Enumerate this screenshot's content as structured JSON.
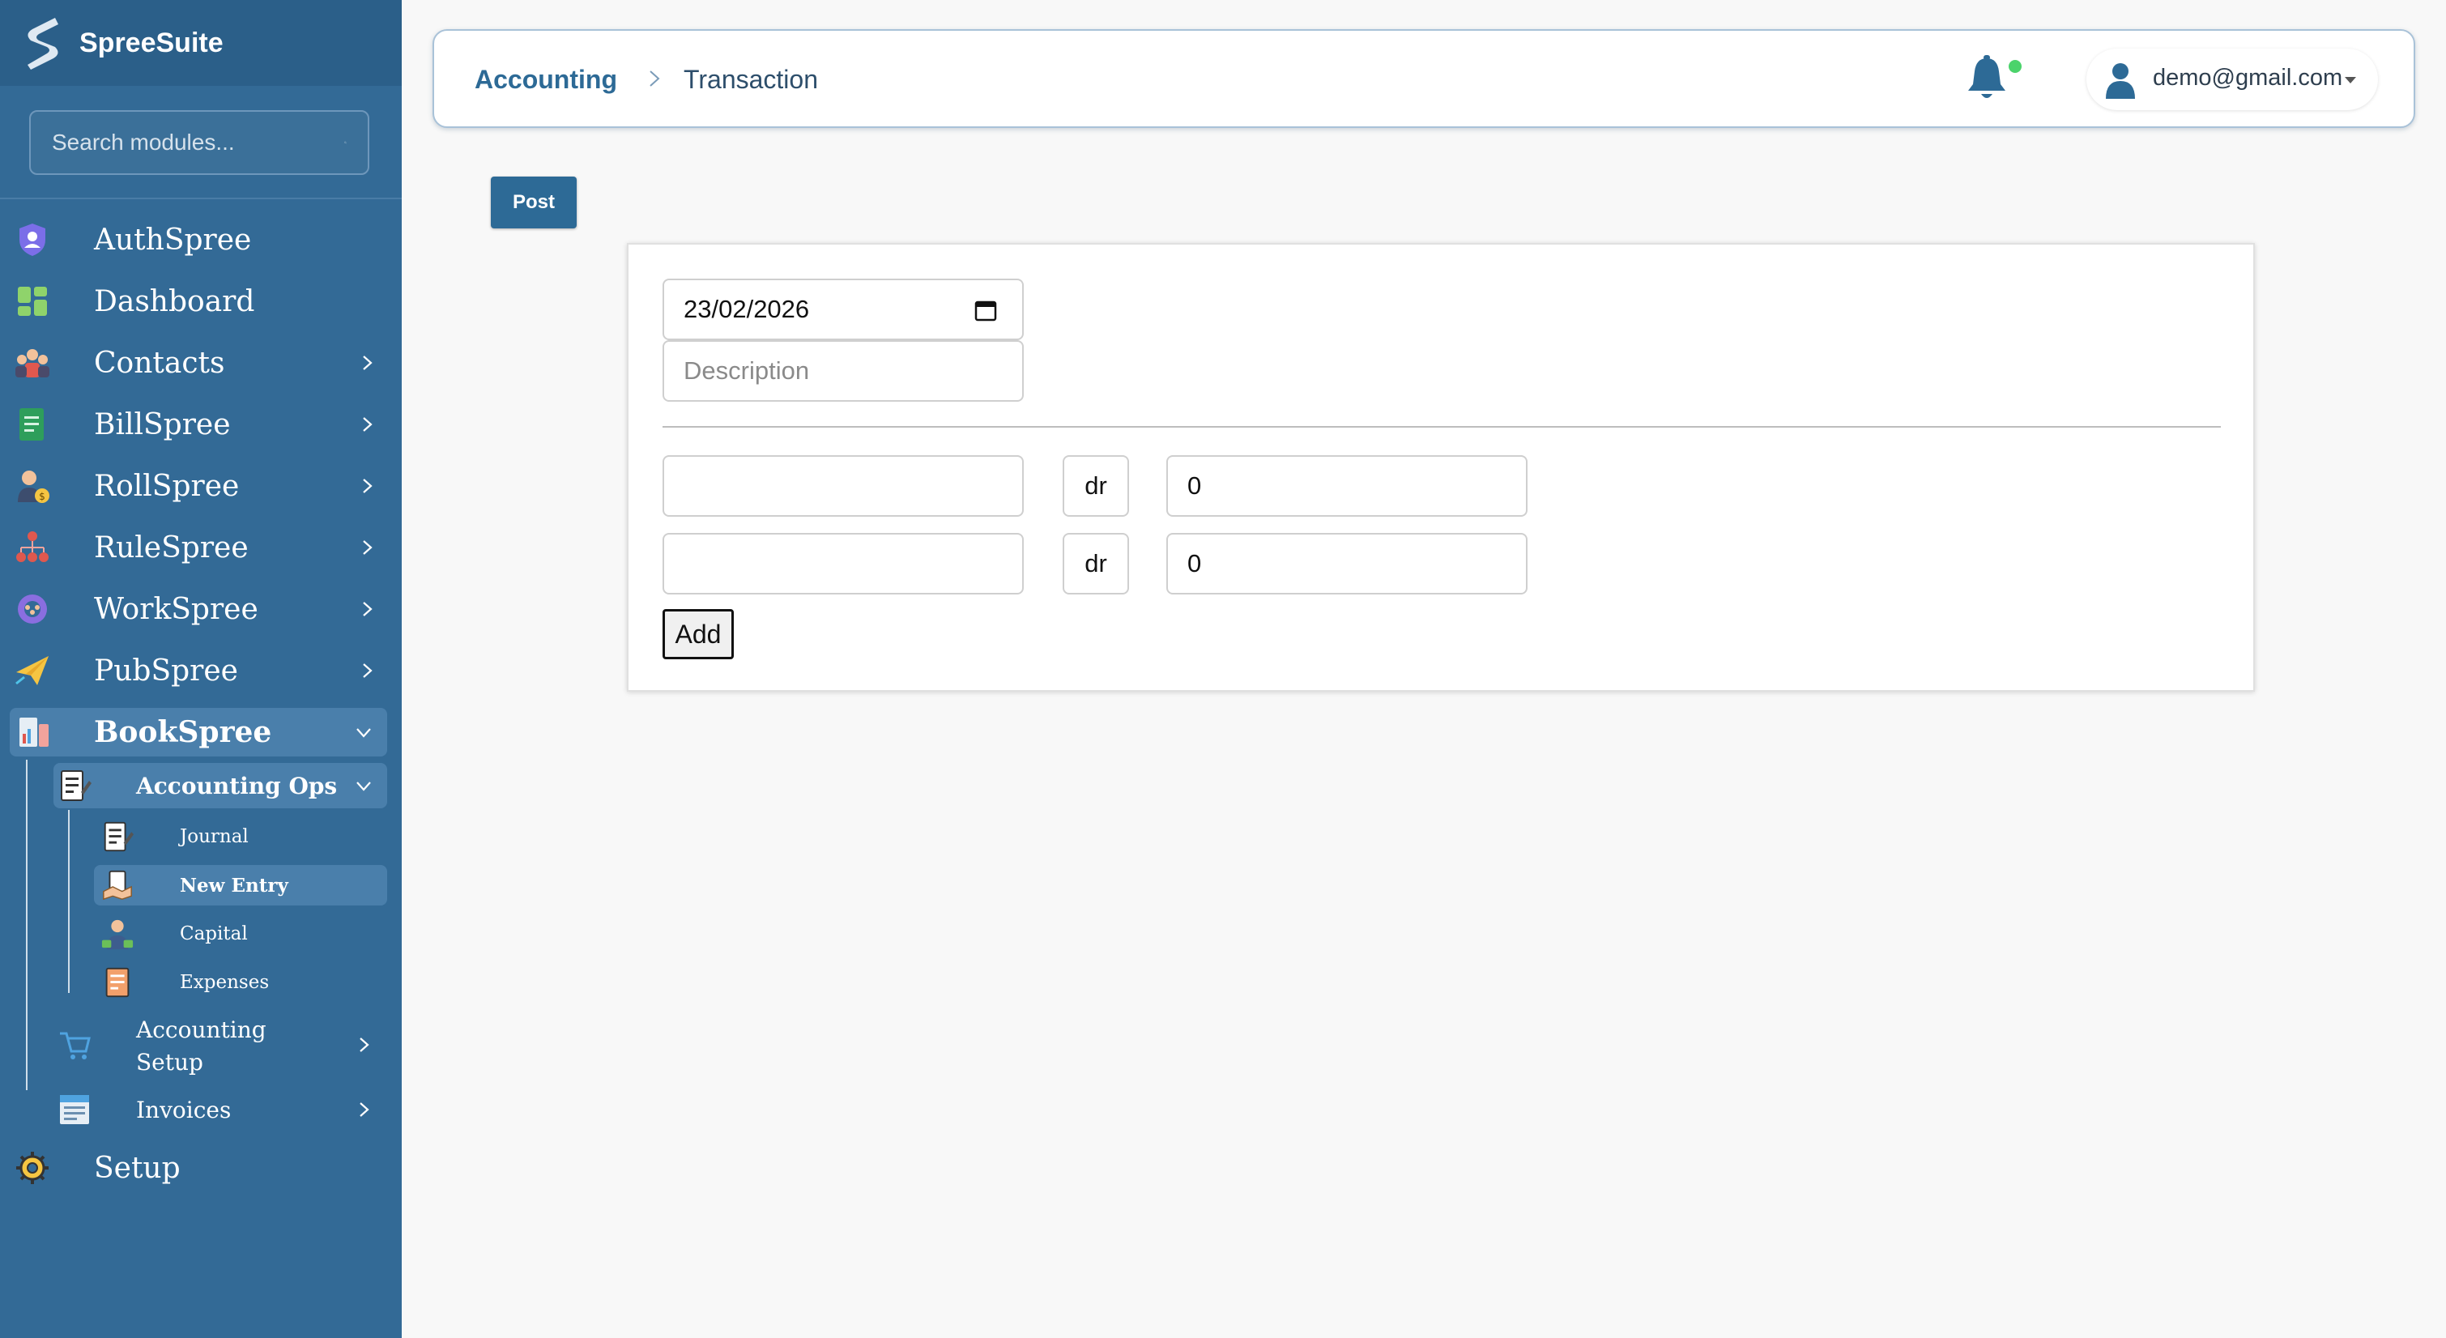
{
  "app": {
    "name": "SpreeSuite"
  },
  "search": {
    "placeholder": "Search modules..."
  },
  "sidebar": {
    "items": [
      {
        "label": "AuthSpree",
        "icon": "shield-user-icon"
      },
      {
        "label": "Dashboard",
        "icon": "dashboard-grid-icon"
      },
      {
        "label": "Contacts",
        "icon": "contacts-people-icon"
      },
      {
        "label": "BillSpree",
        "icon": "bill-document-icon"
      },
      {
        "label": "RollSpree",
        "icon": "payroll-person-icon"
      },
      {
        "label": "RuleSpree",
        "icon": "org-chart-icon"
      },
      {
        "label": "WorkSpree",
        "icon": "team-gear-icon"
      },
      {
        "label": "PubSpree",
        "icon": "paper-plane-icon"
      },
      {
        "label": "BookSpree",
        "icon": "books-chart-icon"
      },
      {
        "label": "Setup",
        "icon": "gear-icon"
      }
    ],
    "bookspree_children": [
      {
        "label": "Accounting Ops",
        "icon": "ledger-pencil-icon"
      },
      {
        "label": "Accounting\nSetup",
        "label_line1": "Accounting",
        "label_line2": "Setup",
        "icon": "cart-setup-icon"
      },
      {
        "label": "Invoices",
        "icon": "invoice-icon"
      }
    ],
    "accounting_ops_children": [
      {
        "label": "Journal",
        "icon": "journal-icon"
      },
      {
        "label": "New Entry",
        "icon": "handshake-entry-icon"
      },
      {
        "label": "Capital",
        "icon": "businessman-money-icon"
      },
      {
        "label": "Expenses",
        "icon": "receipt-icon"
      }
    ]
  },
  "header": {
    "breadcrumb_root": "Accounting",
    "breadcrumb_current": "Transaction",
    "user_email": "demo@gmail.com"
  },
  "toolbar": {
    "post_label": "Post"
  },
  "form": {
    "date_value": "23/02/2026",
    "description_placeholder": "Description",
    "lines": [
      {
        "account": "",
        "side": "dr",
        "amount": "0"
      },
      {
        "account": "",
        "side": "dr",
        "amount": "0"
      }
    ],
    "add_label": "Add"
  },
  "colors": {
    "sidebar_bg": "#336a96",
    "brand_bg": "#2b5f89",
    "accent": "#2d6a96",
    "active_item": "#4a7fab",
    "notification_dot": "#4bd36b"
  }
}
